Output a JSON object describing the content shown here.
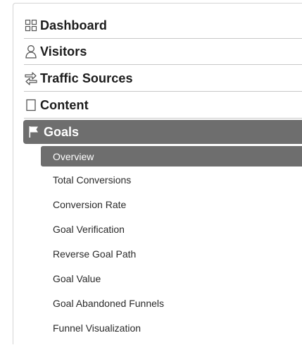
{
  "sections": [
    {
      "label": "Dashboard",
      "icon": "grid-icon"
    },
    {
      "label": "Visitors",
      "icon": "person-icon"
    },
    {
      "label": "Traffic Sources",
      "icon": "arrows-icon"
    },
    {
      "label": "Content",
      "icon": "page-icon"
    }
  ],
  "goals": {
    "label": "Goals",
    "icon": "flag-icon"
  },
  "subitems": [
    {
      "label": "Overview",
      "active": true
    },
    {
      "label": "Total Conversions"
    },
    {
      "label": "Conversion Rate"
    },
    {
      "label": "Goal Verification"
    },
    {
      "label": "Reverse Goal Path"
    },
    {
      "label": "Goal Value"
    },
    {
      "label": "Goal Abandoned Funnels"
    },
    {
      "label": "Funnel Visualization"
    }
  ]
}
